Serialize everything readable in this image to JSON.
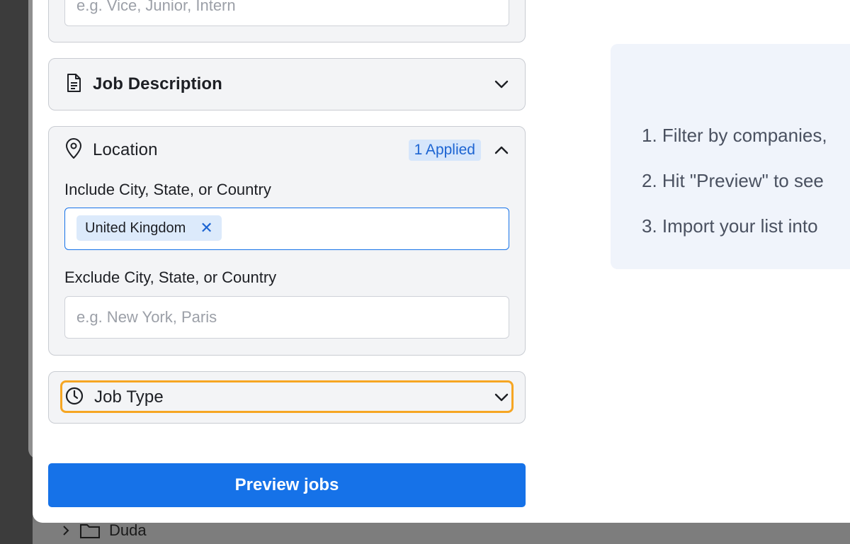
{
  "job_level": {
    "placeholder": "e.g. Vice, Junior, Intern"
  },
  "job_description": {
    "title": "Job Description",
    "icon": "document-icon"
  },
  "location": {
    "title": "Location",
    "icon": "map-pin-icon",
    "applied_badge": "1 Applied",
    "include_label": "Include City, State, or Country",
    "include_tags": [
      "United Kingdom"
    ],
    "exclude_label": "Exclude City, State, or Country",
    "exclude_placeholder": "e.g. New York, Paris"
  },
  "job_type": {
    "title": "Job Type",
    "icon": "clock-icon"
  },
  "preview_button": "Preview jobs",
  "instructions": [
    "1. Filter by companies,",
    "2. Hit \"Preview\" to see",
    "3. Import your list into"
  ],
  "background_item": {
    "label": "Duda"
  },
  "colors": {
    "primary": "#1672e8",
    "badge_bg": "#d6e6fb",
    "badge_text": "#1c64d2",
    "focus_ring": "#f6a623"
  }
}
